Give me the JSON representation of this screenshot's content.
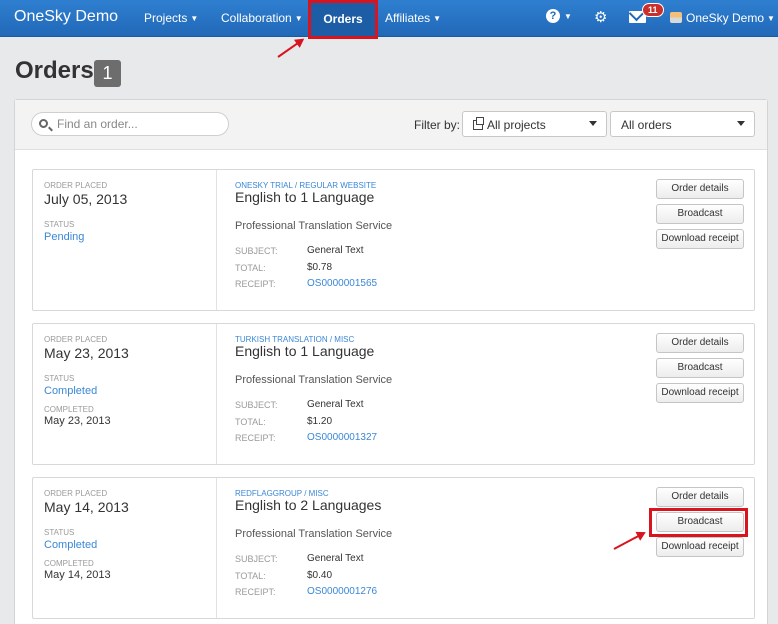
{
  "nav": {
    "brand": "OneSky Demo",
    "items": [
      {
        "label": "Projects"
      },
      {
        "label": "Collaboration"
      },
      {
        "label": "Orders"
      },
      {
        "label": "Affiliates"
      }
    ],
    "mail_badge": "11",
    "user": "OneSky Demo"
  },
  "page": {
    "title": "Orders",
    "count": "1"
  },
  "toolbar": {
    "search_placeholder": "Find an order...",
    "filter_label": "Filter by:",
    "project_filter": "All projects",
    "order_filter": "All orders"
  },
  "labels": {
    "order_placed": "ORDER PLACED",
    "status": "STATUS",
    "completed_on": "COMPLETED",
    "subject": "SUBJECT:",
    "total": "TOTAL:",
    "receipt": "RECEIPT:",
    "btn_details": "Order details",
    "btn_broadcast": "Broadcast",
    "btn_receipt": "Download receipt"
  },
  "orders": [
    {
      "placed": "July 05, 2013",
      "status": "Pending",
      "completed": "",
      "crumb": "ONESKY TRIAL / REGULAR WEBSITE",
      "title": "English to 1 Language",
      "service": "Professional Translation Service",
      "subject": "General Text",
      "total": "$0.78",
      "receipt": "OS0000001565"
    },
    {
      "placed": "May 23, 2013",
      "status": "Completed",
      "completed": "May 23, 2013",
      "crumb": "TURKISH TRANSLATION / MISC",
      "title": "English to 1 Language",
      "service": "Professional Translation Service",
      "subject": "General Text",
      "total": "$1.20",
      "receipt": "OS0000001327"
    },
    {
      "placed": "May 14, 2013",
      "status": "Completed",
      "completed": "May 14, 2013",
      "crumb": "REDFLAGGROUP / MISC",
      "title": "English to 2 Languages",
      "service": "Professional Translation Service",
      "subject": "General Text",
      "total": "$0.40",
      "receipt": "OS0000001276"
    }
  ],
  "colors": {
    "nav": "#2168b8",
    "link": "#3a87d6",
    "highlight": "#d8141e"
  }
}
